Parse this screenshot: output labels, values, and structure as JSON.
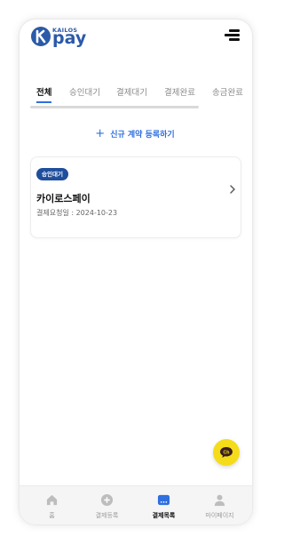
{
  "header": {
    "logo_small": "KAILOS",
    "logo_main": "pay",
    "logo_letter": "K"
  },
  "tabs": [
    {
      "label": "전체",
      "active": true
    },
    {
      "label": "승인대기",
      "active": false
    },
    {
      "label": "결제대기",
      "active": false
    },
    {
      "label": "결제완료",
      "active": false
    },
    {
      "label": "송금완료",
      "active": false
    }
  ],
  "new_contract": {
    "label": "신규 계약 등록하기",
    "icon": "plus-icon"
  },
  "contracts": [
    {
      "badge": "승인대기",
      "title": "카이로스페이",
      "date": "결제요청일 : 2024-10-23"
    }
  ],
  "fab": {
    "icon": "kakao-chat-icon",
    "label": "Ch"
  },
  "bottom_nav": [
    {
      "label": "홈",
      "icon": "home-icon",
      "active": false
    },
    {
      "label": "결제등록",
      "icon": "plus-circle-icon",
      "active": false
    },
    {
      "label": "결제목록",
      "icon": "list-icon",
      "active": true
    },
    {
      "label": "마이페이지",
      "icon": "user-icon",
      "active": false
    }
  ],
  "colors": {
    "brand": "#2b5aa8",
    "accent": "#2f6fe0",
    "badge": "#1f4e9c",
    "kakao": "#f5dc1a"
  }
}
